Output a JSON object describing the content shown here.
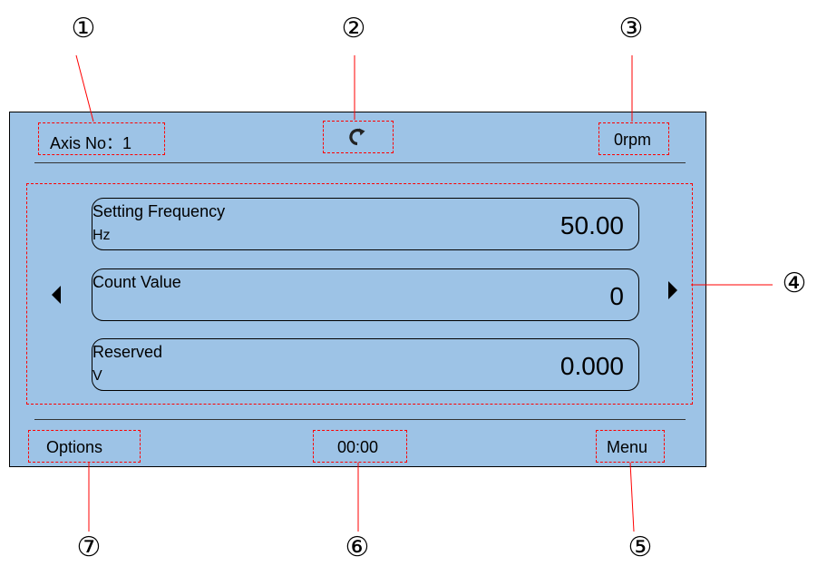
{
  "callouts": [
    "①",
    "②",
    "③",
    "④",
    "⑤",
    "⑥",
    "⑦"
  ],
  "header": {
    "axis_label": "Axis No：1",
    "speed": "0rpm",
    "refresh_icon": "refresh-icon"
  },
  "params": [
    {
      "name": "Setting Frequency",
      "unit": "Hz",
      "value": "50.00"
    },
    {
      "name": "Count Value",
      "unit": "",
      "value": "0"
    },
    {
      "name": "Reserved",
      "unit": "V",
      "value": "0.000"
    }
  ],
  "footer": {
    "options": "Options",
    "time": "00:00",
    "menu": "Menu"
  },
  "colors": {
    "screen_bg": "#9dc3e6",
    "callout_box": "#ff0000"
  }
}
